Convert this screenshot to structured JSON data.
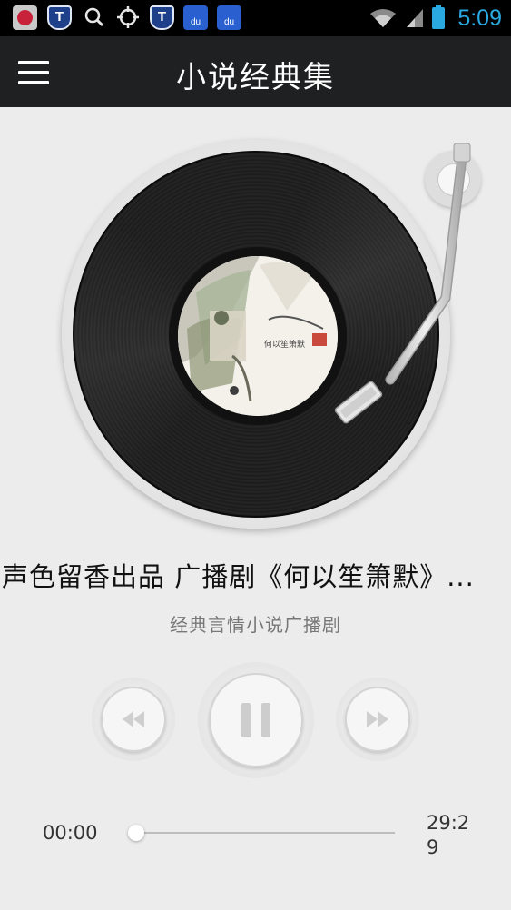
{
  "status_bar": {
    "icons": [
      "app-icon",
      "shield-icon",
      "search-icon",
      "gps-icon",
      "shield-icon",
      "baidu-icon",
      "baidu-icon"
    ],
    "time": "5:09",
    "accent": "#2aa8e0"
  },
  "app_bar": {
    "title": "小说经典集",
    "background": "#1f2022"
  },
  "player": {
    "track_title": "声色留香出品 广播剧《何以笙箫默》...",
    "track_subtitle": "经典言情小说广播剧",
    "state": "playing",
    "controls": [
      "rewind-icon",
      "pause-icon",
      "fast-forward-icon"
    ]
  },
  "progress": {
    "current": "00:00",
    "total": "29:2\n9",
    "fraction": 0
  }
}
